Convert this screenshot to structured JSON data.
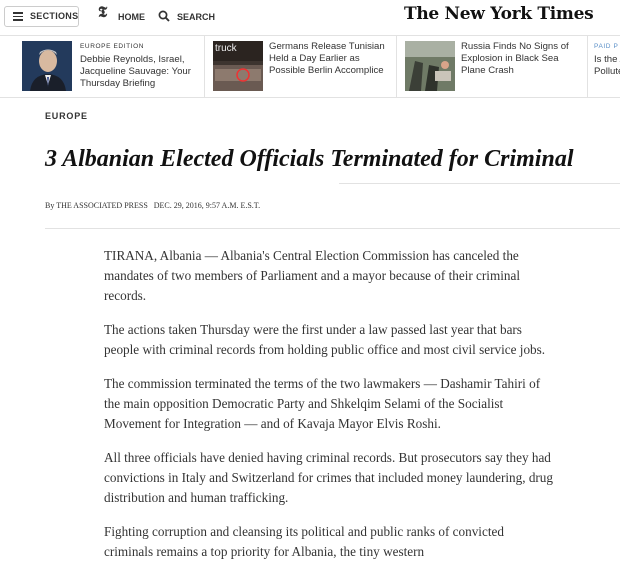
{
  "header": {
    "sections_label": "SECTIONS",
    "home_icon_glyph": "𝕿",
    "home_label": "HOME",
    "search_label": "SEARCH",
    "logo": "The New York Times"
  },
  "ribbon": {
    "items": [
      {
        "kicker": "EUROPE EDITION",
        "title": "Debbie Reynolds, Israel, Jacqueline Sauvage: Your Thursday Briefing"
      },
      {
        "thumb_text": "truck",
        "title": "Germans Release Tunisian Held a Day Earlier as Possible Berlin Accomplice"
      },
      {
        "title": "Russia Finds No Signs of Explosion in Black Sea Plane Crash"
      },
      {
        "kicker": "PAID P",
        "title": "Is the A Pollute"
      }
    ]
  },
  "article": {
    "section": "EUROPE",
    "headline": "3 Albanian Elected Officials Terminated for Criminal",
    "byline": "By THE ASSOCIATED PRESS",
    "dateline": "DEC. 29, 2016, 9:57 A.M. E.S.T.",
    "paragraphs": [
      "TIRANA, Albania — Albania's Central Election Commission has canceled the mandates of two members of Parliament and a mayor because of their criminal records.",
      "The actions taken Thursday were the first under a law passed last year that bars people with criminal records from holding public office and most civil service jobs.",
      "The commission terminated the terms of the two lawmakers — Dashamir Tahiri of the main opposition Democratic Party and Shkelqim Selami of the Socialist Movement for Integration — and of Kavaja Mayor Elvis Roshi.",
      "All three officials have denied having criminal records. But prosecutors say they had convictions in Italy and Switzerland for crimes that included money laundering, drug distribution and human trafficking.",
      "Fighting corruption and cleansing its political and public ranks of convicted criminals remains a top priority for Albania, the tiny western"
    ]
  }
}
